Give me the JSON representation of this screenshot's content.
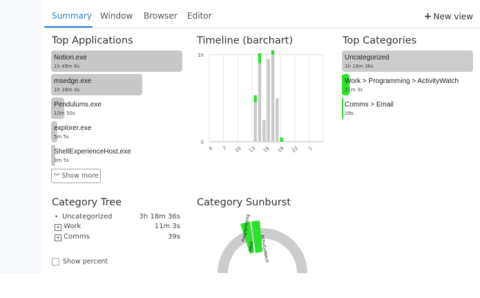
{
  "tabs": [
    {
      "label": "Summary",
      "active": true
    },
    {
      "label": "Window"
    },
    {
      "label": "Browser"
    },
    {
      "label": "Editor"
    }
  ],
  "new_view_label": "New view",
  "top_applications": {
    "title": "Top Applications",
    "items": [
      {
        "name": "Notion.exe",
        "time": "1h 49m 6s",
        "fraction": 1.0
      },
      {
        "name": "msedge.exe",
        "time": "1h 16m 4s",
        "fraction": 0.697
      },
      {
        "name": "Pendulums.exe",
        "time": "10m 50s",
        "fraction": 0.099
      },
      {
        "name": "explorer.exe",
        "time": "5m 5s",
        "fraction": 0.047
      },
      {
        "name": "ShellExperienceHost.exe",
        "time": "3m 5s",
        "fraction": 0.028
      }
    ],
    "show_more_label": "Show more"
  },
  "timeline": {
    "title": "Timeline (barchart)"
  },
  "chart_data": {
    "type": "bar",
    "title": "Timeline (barchart)",
    "categories": [
      "0",
      "1",
      "2",
      "3",
      "4",
      "5",
      "6",
      "7",
      "8",
      "9",
      "10",
      "11",
      "12",
      "13",
      "14",
      "15",
      "16",
      "17",
      "18",
      "19",
      "20",
      "21",
      "22",
      "23",
      "0",
      "1"
    ],
    "x_tick_labels": [
      "4",
      "7",
      "10",
      "13",
      "16",
      "19",
      "22",
      "1"
    ],
    "y_tick_labels": [
      "0",
      "1h"
    ],
    "ylim": [
      0,
      60
    ],
    "series": [
      {
        "color": "#c8c8c8",
        "values": [
          0,
          0,
          0,
          0,
          0,
          0,
          0,
          0,
          0,
          0,
          27,
          54,
          15,
          57,
          60,
          30,
          0,
          0,
          0,
          0,
          0,
          0,
          0,
          0,
          0,
          0
        ]
      },
      {
        "color": "#2be22b",
        "values": [
          0,
          0,
          0,
          0,
          0,
          0,
          0,
          0,
          0,
          0,
          5,
          7,
          0,
          0,
          3,
          0,
          3,
          0,
          0,
          0,
          0,
          0,
          0,
          0,
          0,
          0
        ]
      }
    ]
  },
  "top_categories": {
    "title": "Top Categories",
    "items": [
      {
        "name": "Uncategorized",
        "time": "3h 18m 36s",
        "fraction": 1.0,
        "color": "#cccccc"
      },
      {
        "name": "Work > Programming > ActivityWatch",
        "time": "11m 3s",
        "fraction": 0.056,
        "color": "#2be22b"
      },
      {
        "name": "Comms > Email",
        "time": "39s",
        "fraction": 0.004,
        "color": "#2be22b"
      }
    ]
  },
  "category_tree": {
    "title": "Category Tree",
    "rows": [
      {
        "bullet": "•",
        "name": "Uncategorized",
        "time": "3h 18m 36s"
      },
      {
        "bullet": "+",
        "name": "Work",
        "time": "11m 3s"
      },
      {
        "bullet": "+",
        "name": "Comms",
        "time": "39s"
      }
    ],
    "show_percent_label": "Show percent"
  },
  "category_sunburst": {
    "title": "Category Sunburst",
    "labels": [
      "Programming",
      "Work",
      "ActivityWatch"
    ],
    "colors": {
      "ring": "#cccccc",
      "segment": "#2be22b"
    }
  }
}
